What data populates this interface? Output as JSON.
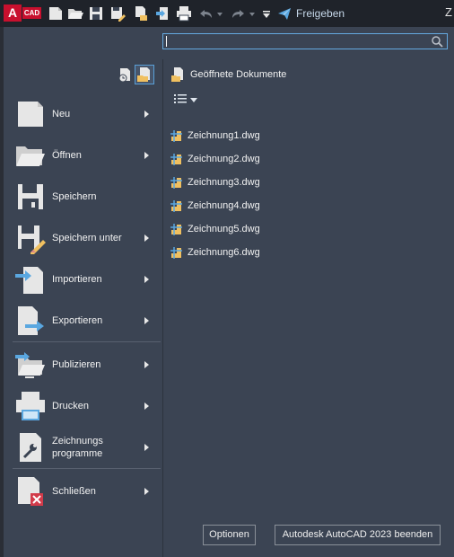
{
  "app": {
    "logo_letter": "A",
    "logo_sub": "CAD",
    "title_fragment": "Z"
  },
  "quick_access": {
    "share_label": "Freigeben"
  },
  "search": {
    "value": "",
    "placeholder": ""
  },
  "left_menu": {
    "items": [
      {
        "label": "Neu",
        "has_submenu": true
      },
      {
        "label": "Öffnen",
        "has_submenu": true
      },
      {
        "label": "Speichern",
        "has_submenu": false
      },
      {
        "label": "Speichern unter",
        "has_submenu": true
      },
      {
        "label": "Importieren",
        "has_submenu": true
      },
      {
        "label": "Exportieren",
        "has_submenu": true
      },
      {
        "label": "Publizieren",
        "has_submenu": true
      },
      {
        "label": "Drucken",
        "has_submenu": true
      },
      {
        "label": "Zeichnungs\nprogramme",
        "has_submenu": true
      },
      {
        "label": "Schließen",
        "has_submenu": true
      }
    ]
  },
  "recent": {
    "header": "Geöffnete Dokumente",
    "documents": [
      "Zeichnung1.dwg",
      "Zeichnung2.dwg",
      "Zeichnung3.dwg",
      "Zeichnung4.dwg",
      "Zeichnung5.dwg",
      "Zeichnung6.dwg"
    ]
  },
  "footer": {
    "options_label": "Optionen",
    "exit_label": "Autodesk AutoCAD 2023 beenden"
  },
  "colors": {
    "accent": "#65a9e0",
    "brand": "#c8102e",
    "panel": "#3b4453"
  }
}
